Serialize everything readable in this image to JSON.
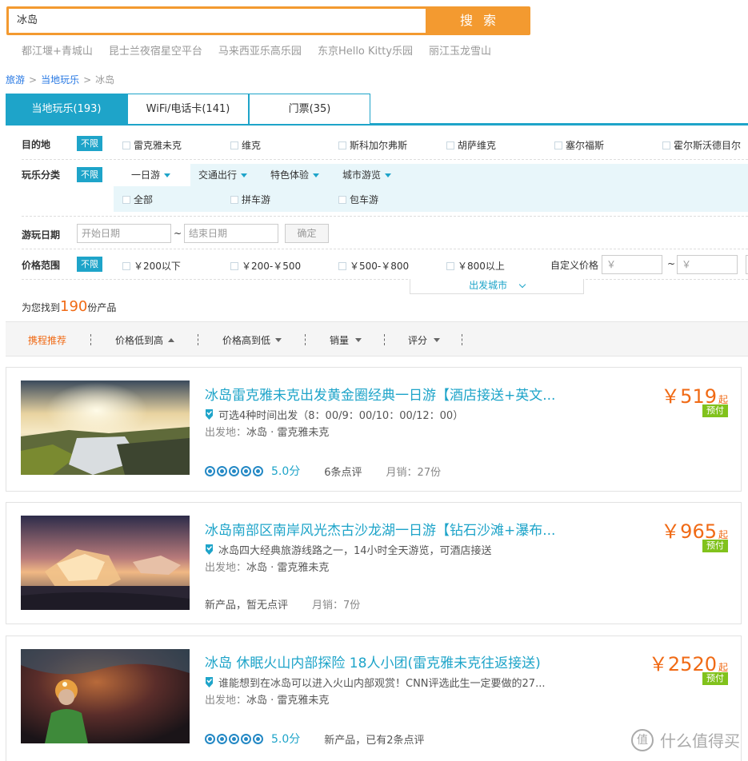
{
  "search": {
    "value": "冰岛",
    "button_label": "搜 索",
    "hot_links": [
      "都江堰+青城山",
      "昆士兰夜宿星空平台",
      "马来西亚乐高乐园",
      "东京Hello Kitty乐园",
      "丽江玉龙雪山"
    ]
  },
  "breadcrumb": {
    "items": [
      "旅游",
      "当地玩乐",
      "冰岛"
    ],
    "separator": ">"
  },
  "tabs": [
    {
      "label": "当地玩乐(193)",
      "active": true
    },
    {
      "label": "WiFi/电话卡(141)",
      "active": false
    },
    {
      "label": "门票(35)",
      "active": false
    }
  ],
  "filters": {
    "destination": {
      "label": "目的地",
      "unlimited": "不限",
      "options": [
        "雷克雅未克",
        "维克",
        "斯科加尔弗斯",
        "胡萨维克",
        "塞尔福斯",
        "霍尔斯沃德目尔"
      ]
    },
    "category": {
      "label": "玩乐分类",
      "unlimited": "不限",
      "tabs": [
        "一日游",
        "交通出行",
        "特色体验",
        "城市游览"
      ],
      "sub_options": [
        "全部",
        "拼车游",
        "包车游"
      ]
    },
    "date": {
      "label": "游玩日期",
      "start_placeholder": "开始日期",
      "tilde": "~",
      "end_placeholder": "结束日期",
      "confirm": "确定"
    },
    "price": {
      "label": "价格范围",
      "unlimited": "不限",
      "options": [
        "￥200以下",
        "￥200-￥500",
        "￥500-￥800",
        "￥800以上"
      ],
      "custom_label": "自定义价格",
      "min_placeholder": "￥",
      "tilde": "~",
      "max_placeholder": "￥"
    },
    "departure_city": "出发城市"
  },
  "results": {
    "prefix": "为您找到",
    "count": "190",
    "suffix": "份产品"
  },
  "sort": {
    "items": [
      "携程推荐",
      "价格低到高",
      "价格高到低",
      "销量",
      "评分"
    ],
    "active_index": 0
  },
  "products": [
    {
      "title": "冰岛雷克雅未克出发黄金圈经典一日游【酒店接送+英文...",
      "feature": "可选4种时间出发（8：00/9：00/10：00/12：00）",
      "depart_label": "出发地：",
      "depart_value": "冰岛 · 雷克雅未克",
      "price": "￥519",
      "price_suffix": "起",
      "prepay": "预付",
      "score": "5.0分",
      "reviews": "6条点评",
      "sales": "月销：27份"
    },
    {
      "title": "冰岛南部区南岸风光杰古沙龙湖一日游【钻石沙滩+瀑布...",
      "feature": "冰岛四大经典旅游线路之一，14小时全天游览，可酒店接送",
      "depart_label": "出发地：",
      "depart_value": "冰岛 · 雷克雅未克",
      "price": "￥965",
      "price_suffix": "起",
      "prepay": "预付",
      "reviews": "新产品，暂无点评",
      "sales": "月销：7份"
    },
    {
      "title": "冰岛 休眠火山内部探险 18人小团(雷克雅未克往返接送)",
      "feature": "谁能想到在冰岛可以进入火山内部观赏！CNN评选此生一定要做的27...",
      "depart_label": "出发地：",
      "depart_value": "冰岛 · 雷克雅未克",
      "price": "￥2520",
      "price_suffix": "起",
      "prepay": "预付",
      "score": "5.0分",
      "reviews": "新产品，已有2条点评"
    }
  ],
  "watermark": {
    "text": "什么值得买",
    "icon_char": "值"
  },
  "colors": {
    "accent": "#1ea4c9",
    "search_orange": "#f39a30",
    "price_orange": "#f06a15",
    "prepay_green": "#81c21c"
  }
}
